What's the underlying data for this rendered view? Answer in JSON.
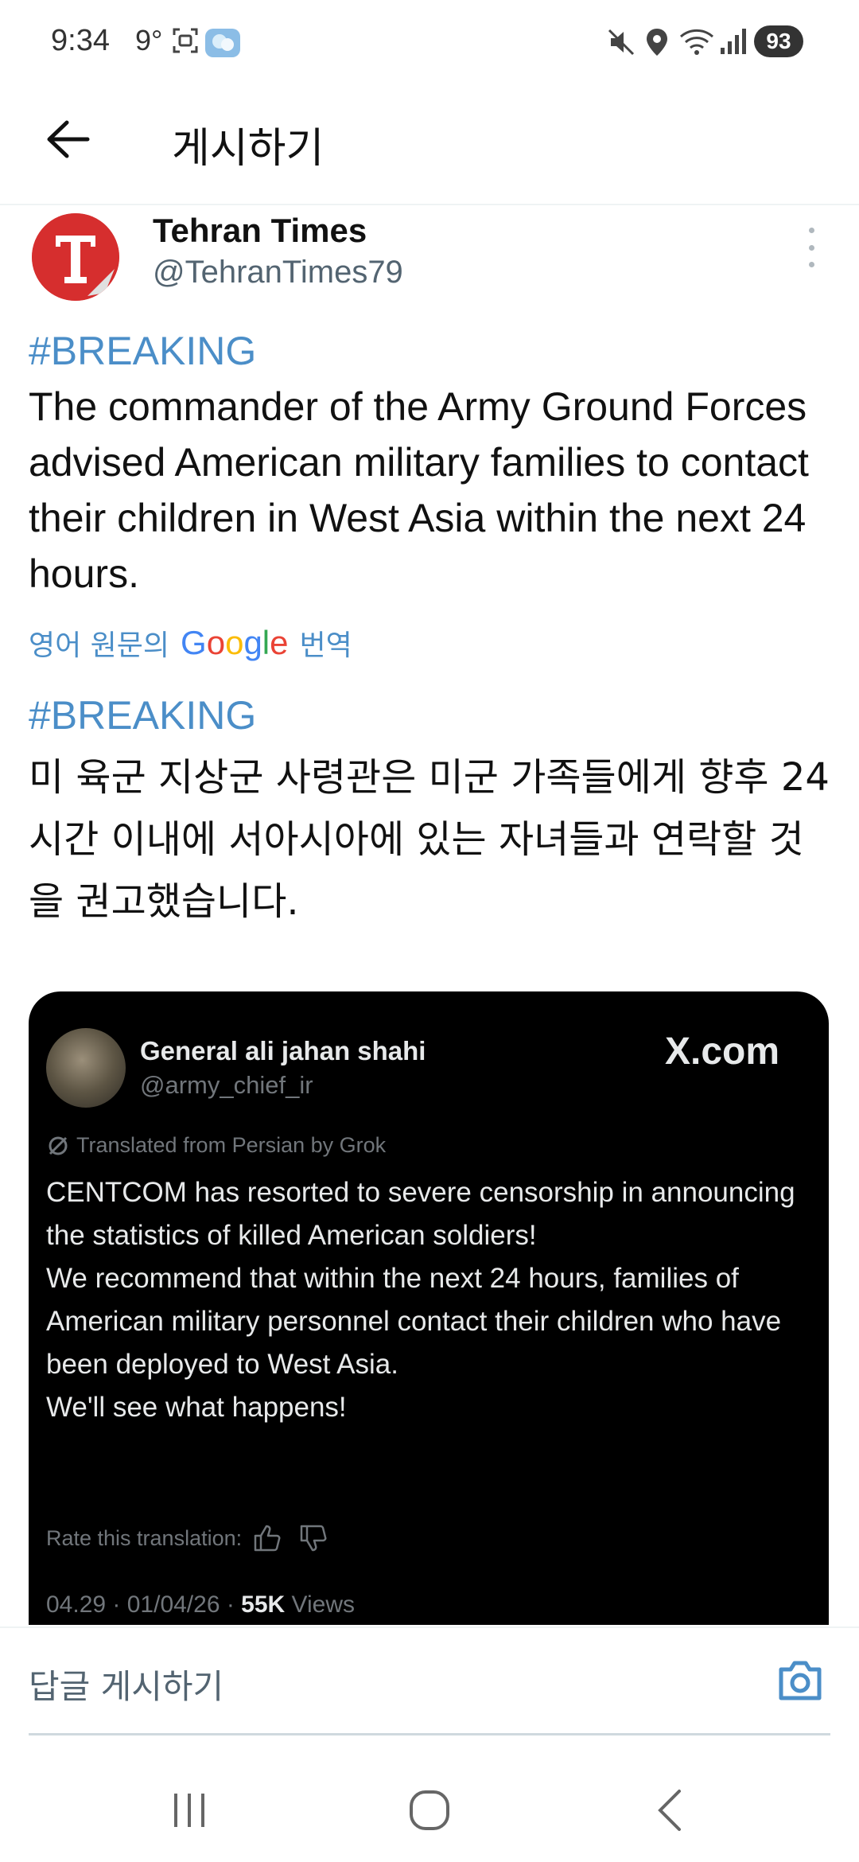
{
  "status_bar": {
    "time": "9:34",
    "temperature": "9°",
    "battery": "93",
    "icons": [
      "screenshot-icon",
      "weather-icon",
      "mute-icon",
      "location-icon",
      "wifi-icon",
      "signal-icon"
    ]
  },
  "header": {
    "title": "게시하기",
    "back_icon": "arrow-left-icon"
  },
  "post": {
    "author_name": "Tehran Times",
    "author_handle": "@TehranTimes79",
    "avatar_letter": "T",
    "hashtag_en": "#BREAKING",
    "text_en": " The commander of the Army Ground Forces advised American military families to contact their children in West Asia within the next 24 hours.",
    "translate_prefix": "영어 원문의",
    "translate_brand": "Google",
    "translate_suffix": "번역",
    "hashtag_ko": "#BREAKING",
    "text_ko": "미 육군 지상군 사령관은 미군 가족들에게 향후 24시간 이내에 서아시아에 있는 자녀들과 연락할 것을 권고했습니다."
  },
  "embed": {
    "name": "General ali jahan shahi",
    "handle": "@army_chief_ir",
    "source": "X.com",
    "translated_note": "Translated from Persian by Grok",
    "paragraph_1": "CENTCOM has resorted to severe censorship in announcing the statistics of killed American soldiers!",
    "paragraph_2": "We recommend that within the next 24 hours, families of American military personnel contact their children who have been deployed to West Asia.",
    "paragraph_3": "We'll see what happens!",
    "rate_label": "Rate this translation:",
    "date": "04.29 · 01/04/26 · ",
    "views_count": "55K",
    "views_label": " Views"
  },
  "reply": {
    "placeholder": "답글 게시하기"
  },
  "colors": {
    "accent": "#4b8ec8",
    "text": "#111111",
    "secondary": "#536471",
    "embed_bg": "#000000"
  }
}
